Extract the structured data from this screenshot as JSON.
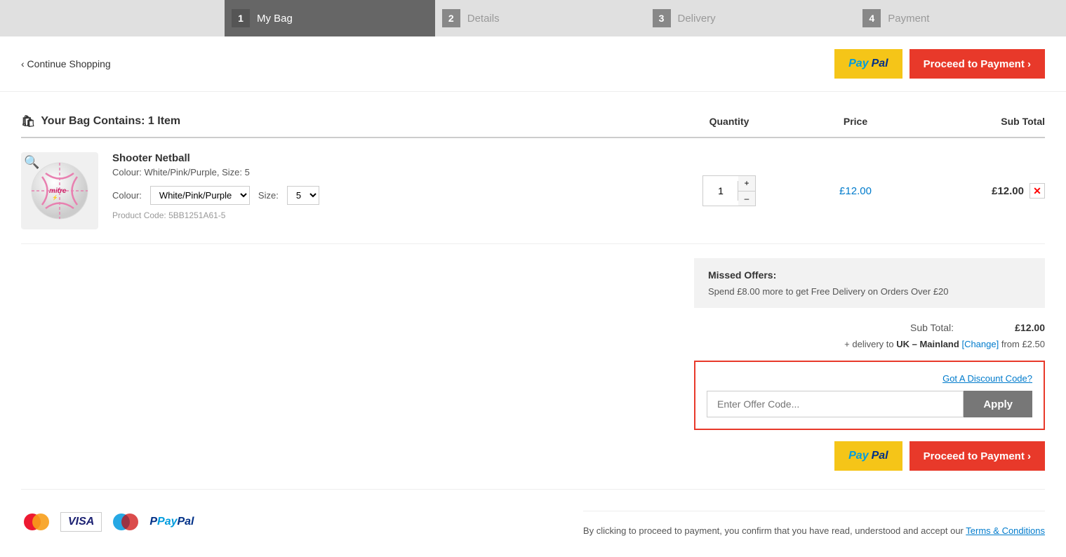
{
  "progress": {
    "steps": [
      {
        "number": "1",
        "label": "My Bag",
        "active": true
      },
      {
        "number": "2",
        "label": "Details",
        "active": false
      },
      {
        "number": "3",
        "label": "Delivery",
        "active": false
      },
      {
        "number": "4",
        "label": "Payment",
        "active": false
      }
    ]
  },
  "header": {
    "continue_shopping": "‹ Continue Shopping",
    "paypal_pay": "Pay",
    "paypal_pal": "Pal",
    "proceed_button": "Proceed to Payment ›"
  },
  "bag": {
    "title": "Your Bag Contains: 1 Item",
    "bag_icon": "🛍",
    "col_quantity": "Quantity",
    "col_price": "Price",
    "col_subtotal": "Sub Total"
  },
  "product": {
    "name": "Shooter Netball",
    "variant": "Colour: White/Pink/Purple, Size: 5",
    "colour_label": "Colour:",
    "colour_value": "White/Pink/Purple",
    "size_label": "Size:",
    "size_value": "5",
    "product_code_label": "Product Code:",
    "product_code": "5BB1251A61-5",
    "quantity": "1",
    "price": "£12.00",
    "subtotal": "£12.00"
  },
  "missed_offers": {
    "title": "Missed Offers:",
    "text": "Spend £8.00 more to get Free Delivery on Orders Over £20"
  },
  "summary": {
    "sub_total_label": "Sub Total:",
    "sub_total_value": "£12.00",
    "delivery_text": "+ delivery to",
    "delivery_destination": "UK – Mainland",
    "delivery_change": "[Change]",
    "delivery_from": "from £2.50"
  },
  "discount": {
    "link_text": "Got A Discount Code?",
    "placeholder": "Enter Offer Code...",
    "apply_label": "Apply"
  },
  "bottom": {
    "proceed_button": "Proceed to Payment ›",
    "footer_text": "By clicking to proceed to payment, you confirm that you have read, understood and accept our",
    "terms_link": "Terms & Conditions"
  },
  "payment_icons": {
    "mastercard_label": "mastercard",
    "visa_label": "VISA",
    "maestro_label": "maestro",
    "paypal_label": "PayPal"
  }
}
